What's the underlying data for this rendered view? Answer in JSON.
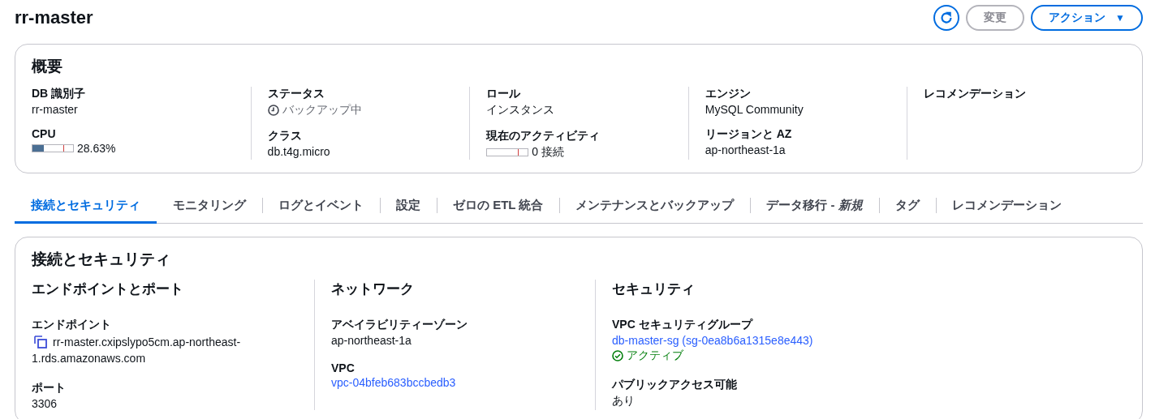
{
  "page": {
    "title": "rr-master"
  },
  "header_actions": [
    {
      "kind": "icon",
      "disabled": false
    },
    {
      "kind": "text",
      "label": "変更",
      "disabled": true
    },
    {
      "kind": "dropdown",
      "label": "アクション",
      "caret": "▼",
      "disabled": false
    }
  ],
  "summary": {
    "title": "概要",
    "columns": [
      [
        {
          "label": "DB 識別子",
          "kind": "text",
          "value": "rr-master"
        },
        {
          "label": "CPU",
          "kind": "meter",
          "level": 0.28,
          "reading": "28.63%"
        }
      ],
      [
        {
          "label": "ステータス",
          "kind": "status",
          "success": false,
          "value": "バックアップ中"
        },
        {
          "label": "クラス",
          "kind": "text",
          "value": "db.t4g.micro"
        }
      ],
      [
        {
          "label": "ロール",
          "kind": "text",
          "value": "インスタンス"
        },
        {
          "label": "現在のアクティビティ",
          "kind": "meter",
          "level": 0,
          "reading": "0 接続"
        }
      ],
      [
        {
          "label": "エンジン",
          "kind": "text",
          "value": "MySQL Community"
        },
        {
          "label": "リージョンと AZ",
          "kind": "text",
          "value": "ap-northeast-1a"
        }
      ],
      [
        {
          "label": "レコメンデーション",
          "kind": "label"
        }
      ]
    ]
  },
  "tabs": [
    {
      "label": "接続とセキュリティ",
      "selected": true
    },
    {
      "label": "モニタリング",
      "selected": false
    },
    {
      "label": "ログとイベント",
      "selected": false
    },
    {
      "label": "設定",
      "selected": false
    },
    {
      "label": "ゼロの ETL 統合",
      "selected": false
    },
    {
      "label": "メンテナンスとバックアップ",
      "selected": false
    },
    {
      "label": "データ移行 - *新規*",
      "selected": false
    },
    {
      "label": "タグ",
      "selected": false
    },
    {
      "label": "レコメンデーション",
      "selected": false
    }
  ],
  "connectivity": {
    "title": "接続とセキュリティ",
    "columns": [
      {
        "heading": "エンドポイントとポート",
        "fields": [
          {
            "label": "エンドポイント",
            "kind": "copy",
            "value": "rr-master.cxipslypo5cm.ap-northeast-1.rds.amazonaws.com"
          },
          {
            "label": "ポート",
            "kind": "text",
            "value": "3306"
          }
        ]
      },
      {
        "heading": "ネットワーク",
        "fields": [
          {
            "label": "アベイラビリティーゾーン",
            "kind": "text",
            "value": "ap-northeast-1a"
          },
          {
            "label": "VPC",
            "kind": "link",
            "value": "vpc-04bfeb683bccbedb3"
          }
        ]
      },
      {
        "heading": "セキュリティ",
        "fields": [
          {
            "label": "VPC セキュリティグループ",
            "kind": "link",
            "value": "db-master-sg (sg-0ea8b6a1315e8e443)",
            "success": true,
            "status_text": "アクティブ"
          },
          {
            "label": "パブリックアクセス可能",
            "kind": "text",
            "value": "あり"
          }
        ]
      }
    ]
  }
}
